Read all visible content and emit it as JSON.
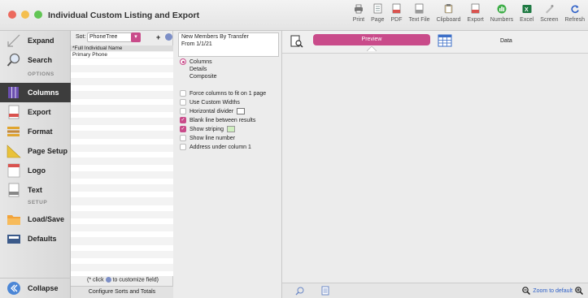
{
  "window": {
    "title": "Individual Custom Listing and Export",
    "traffic_lights": [
      "#ec6a5e",
      "#f4bf4f",
      "#61c554"
    ]
  },
  "toolbar": [
    {
      "label": "Print",
      "icon": "printer-icon"
    },
    {
      "label": "Page",
      "icon": "page-icon"
    },
    {
      "label": "PDF",
      "icon": "pdf-icon"
    },
    {
      "label": "Text File",
      "icon": "text-file-icon"
    },
    {
      "label": "Clipboard",
      "icon": "clipboard-icon"
    },
    {
      "label": "Export",
      "icon": "export-icon"
    },
    {
      "label": "Numbers",
      "icon": "numbers-icon"
    },
    {
      "label": "Excel",
      "icon": "excel-icon"
    },
    {
      "label": "Screen",
      "icon": "screen-icon"
    },
    {
      "label": "Refresh",
      "icon": "refresh-icon"
    }
  ],
  "sidebar": {
    "items": [
      {
        "label": "Expand",
        "icon": "expand-icon"
      },
      {
        "label": "Search",
        "icon": "magnifier-icon"
      },
      {
        "label": "Columns",
        "icon": "columns-icon"
      },
      {
        "label": "Export",
        "icon": "csv-export-icon"
      },
      {
        "label": "Format",
        "icon": "format-icon"
      },
      {
        "label": "Page Setup",
        "icon": "page-setup-icon"
      },
      {
        "label": "Logo",
        "icon": "logo-icon"
      },
      {
        "label": "Text",
        "icon": "text-doc-icon"
      },
      {
        "label": "Load/Save",
        "icon": "folder-icon"
      },
      {
        "label": "Defaults",
        "icon": "defaults-icon"
      },
      {
        "label": "Collapse",
        "icon": "collapse-icon"
      }
    ],
    "headings": {
      "options": "OPTIONS",
      "setup": "SETUP"
    }
  },
  "fields_panel": {
    "sort_label": "Sot:",
    "sort_value": "PhoneTree",
    "plus": "+",
    "fields": [
      "*Full Individual Name",
      "Primary Phone"
    ],
    "hint_prefix": "(* click",
    "hint_suffix": "to customize field)",
    "configure_button": "Configure Sorts and Totals"
  },
  "options_panel": {
    "report_title_line1": "New Members By Transfer",
    "report_title_line2": "From 1/1/21",
    "layout_options": [
      {
        "label": "Columns",
        "selected": true
      },
      {
        "label": "Details",
        "selected": false
      },
      {
        "label": "Composite",
        "selected": false
      }
    ],
    "checkboxes": [
      {
        "label": "Force columns to fit on 1 page",
        "checked": false
      },
      {
        "label": "Use Custom Widths",
        "checked": false
      },
      {
        "label": "Horizontal divider",
        "checked": false
      },
      {
        "label": "Blank line between results",
        "checked": true
      },
      {
        "label": "Show striping",
        "checked": true
      },
      {
        "label": "Show line number",
        "checked": false
      },
      {
        "label": "Address under column 1",
        "checked": false
      }
    ]
  },
  "preview": {
    "preview_button": "Preview",
    "data_label": "Data",
    "zoom_label": "Zoom to default"
  },
  "colors": {
    "accent": "#c94b8a",
    "link": "#2d5fc7",
    "active_sidebar": "#3d3d3d"
  }
}
